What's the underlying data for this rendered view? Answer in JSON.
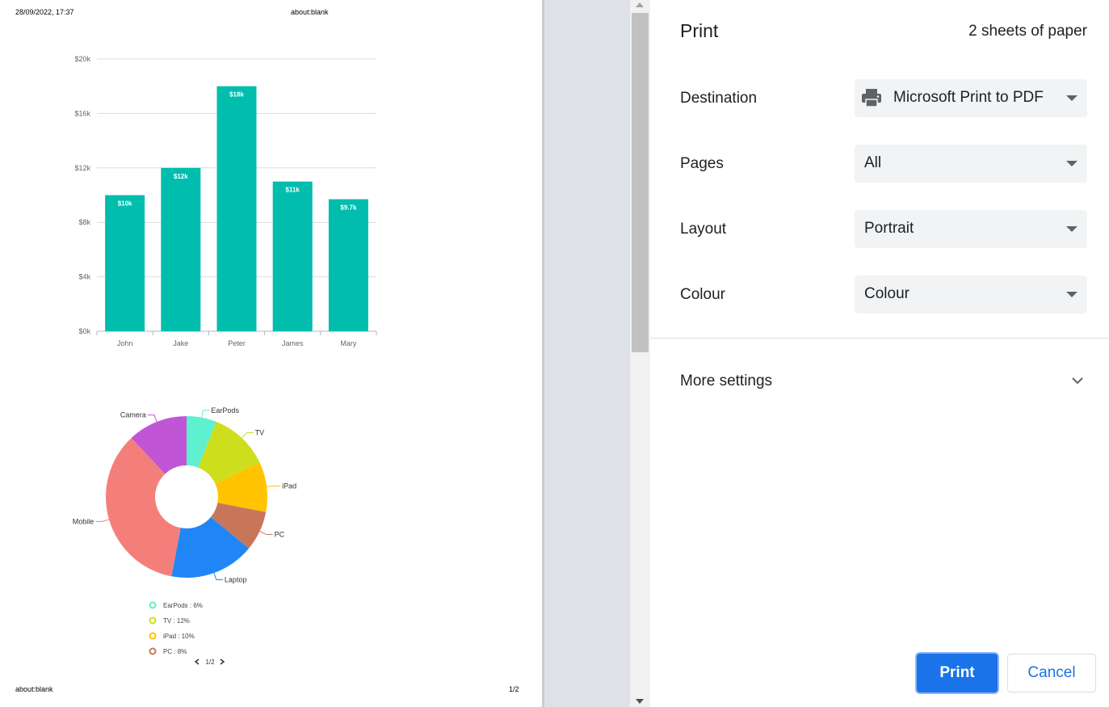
{
  "preview": {
    "header_date": "28/09/2022, 17:37",
    "header_url": "about:blank",
    "footer_url": "about:blank",
    "footer_page": "1/2"
  },
  "chart_data": [
    {
      "type": "bar",
      "categories": [
        "John",
        "Jake",
        "Peter",
        "James",
        "Mary"
      ],
      "values": [
        10000,
        12000,
        18000,
        11000,
        9700
      ],
      "data_labels": [
        "$10k",
        "$12k",
        "$18k",
        "$11k",
        "$9.7k"
      ],
      "ylim": [
        0,
        20000
      ],
      "yticks": [
        0,
        4000,
        8000,
        12000,
        16000,
        20000
      ],
      "ytick_labels": [
        "$0k",
        "$4k",
        "$8k",
        "$12k",
        "$16k",
        "$20k"
      ],
      "color": "#00bdae",
      "grid": true
    },
    {
      "type": "pie",
      "donut": true,
      "slices": [
        {
          "label": "EarPods",
          "value": 6,
          "color": "#5ff0d0"
        },
        {
          "label": "TV",
          "value": 12,
          "color": "#cddf1c"
        },
        {
          "label": "iPad",
          "value": 10,
          "color": "#ffc300"
        },
        {
          "label": "PC",
          "value": 8,
          "color": "#c8765a"
        },
        {
          "label": "Laptop",
          "value": 17,
          "color": "#2186f5"
        },
        {
          "label": "Mobile",
          "value": 35,
          "color": "#f47f7a"
        },
        {
          "label": "Camera",
          "value": 12,
          "color": "#c056d6"
        }
      ],
      "legend_items": [
        "EarPods : 6%",
        "TV : 12%",
        "iPad : 10%",
        "PC : 8%"
      ],
      "legend_page": "1/2",
      "legend_prev_icon": "chevron-left",
      "legend_next_icon": "chevron-right"
    }
  ],
  "print_panel": {
    "title": "Print",
    "sheets": "2 sheets of paper",
    "destination": {
      "label": "Destination",
      "value": "Microsoft Print to PDF",
      "icon": "printer-icon"
    },
    "pages": {
      "label": "Pages",
      "value": "All"
    },
    "layout": {
      "label": "Layout",
      "value": "Portrait"
    },
    "colour": {
      "label": "Colour",
      "value": "Colour"
    },
    "more_settings": "More settings",
    "print_button": "Print",
    "cancel_button": "Cancel",
    "accent_color": "#1a73e8"
  }
}
